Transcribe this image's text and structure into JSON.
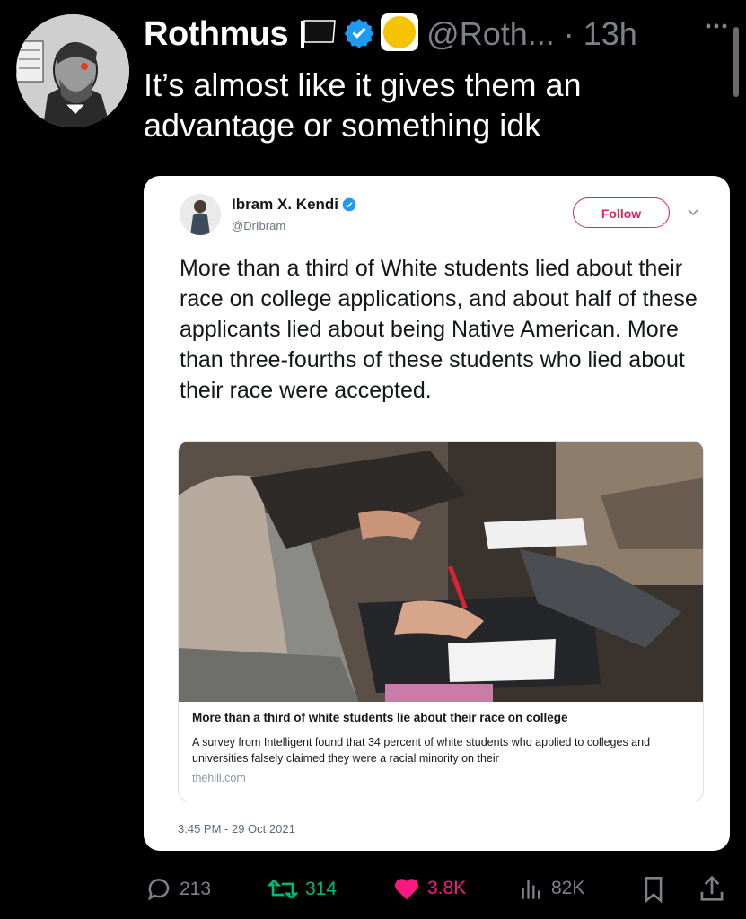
{
  "tweet": {
    "display_name": "Rothmus",
    "handle_time": "@Roth... · 13h",
    "text": "It’s almost like it gives them an advantage or something idk"
  },
  "quoted": {
    "name": "Ibram X. Kendi",
    "handle": "@DrIbram",
    "follow_label": "Follow",
    "text": "More than a third of White students lied about their race on college applications, and about half of these applicants lied about being Native American. More than three-fourths of these students who lied about their race were accepted.",
    "link_title": "More than a third of white students lie about their race on college",
    "link_description": "A survey from Intelligent found that 34 percent of white students who applied to colleges and universities falsely claimed they were a racial minority on their",
    "link_domain": "thehill.com",
    "timestamp": "3:45 PM - 29 Oct 2021"
  },
  "actions": {
    "replies": "213",
    "retweets": "314",
    "likes": "3.8K",
    "views": "82K"
  },
  "colors": {
    "retweet": "#00ba7c",
    "like": "#f91880",
    "verified": "#1d9bf0",
    "follow": "#e0245e"
  }
}
